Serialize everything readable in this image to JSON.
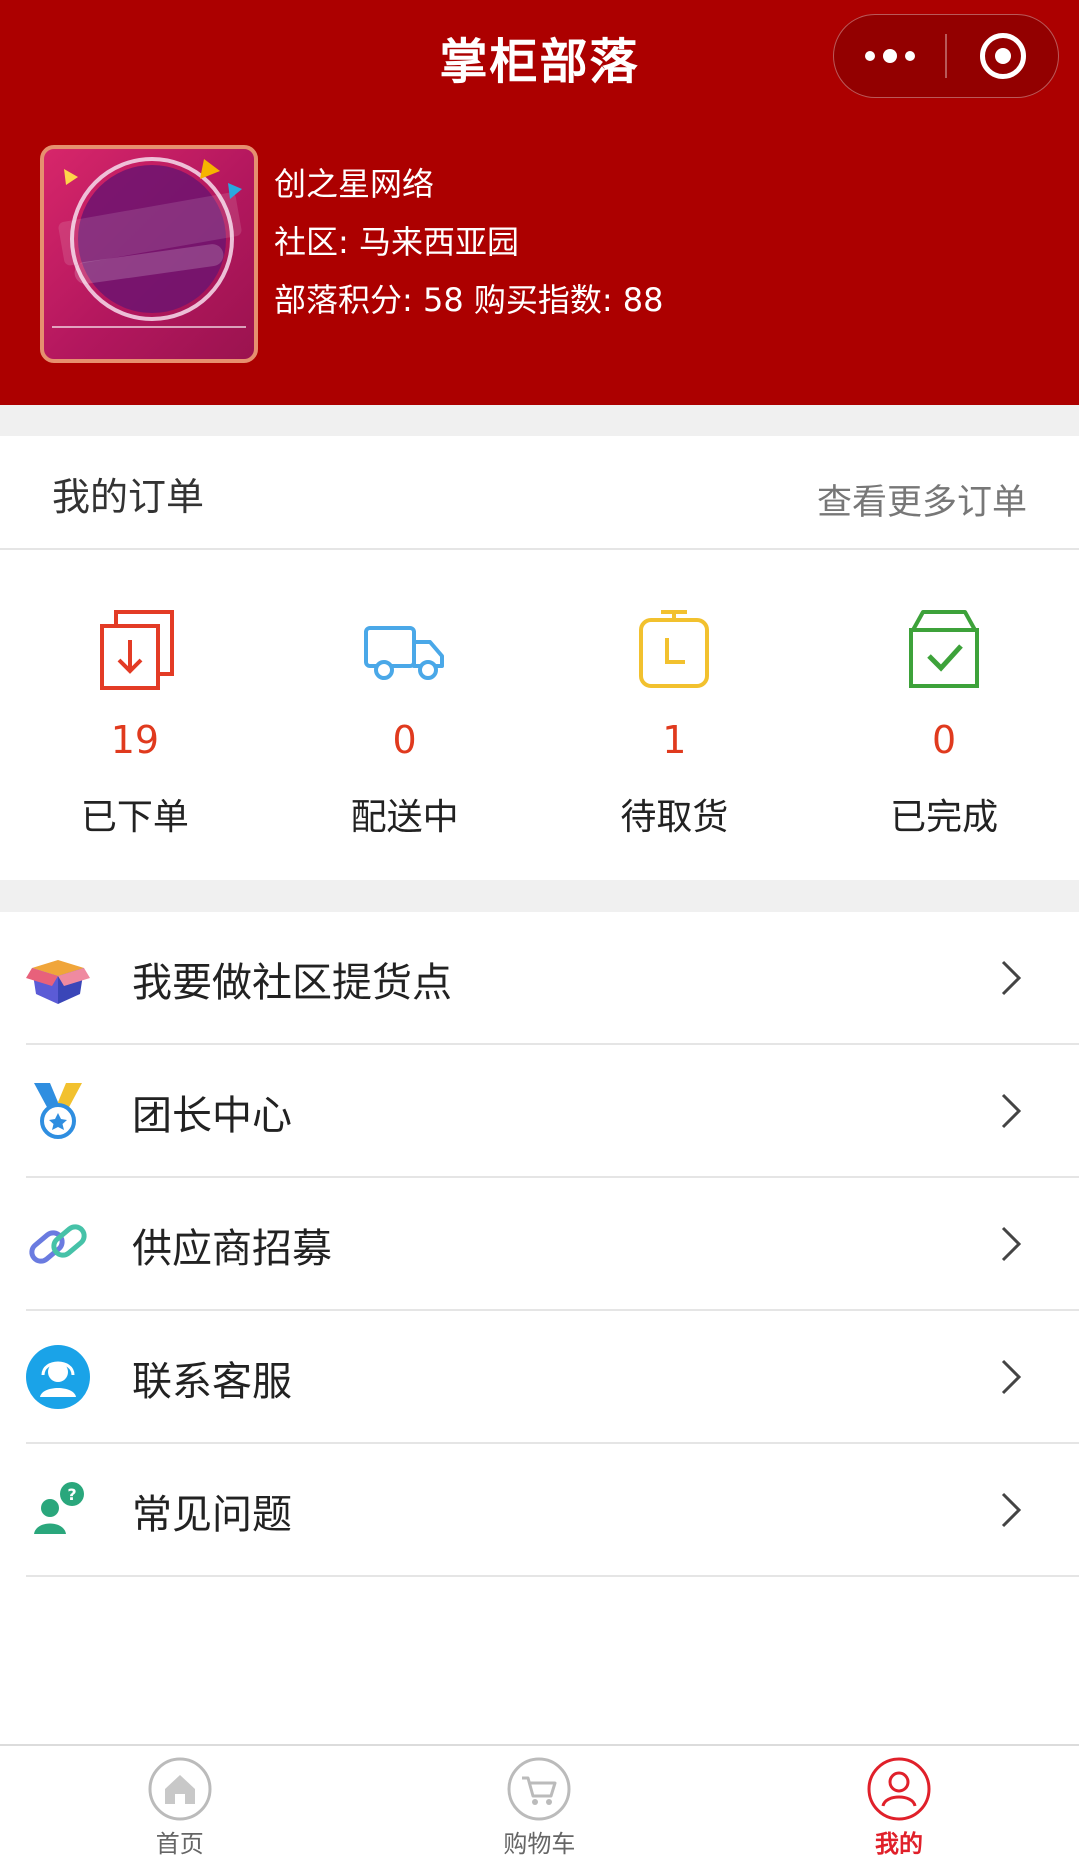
{
  "header": {
    "title": "掌柜部落",
    "menu_icon": "more-dots-icon",
    "close_icon": "target-circle-icon",
    "background": "#ac0000"
  },
  "profile": {
    "avatar_icon": "wechat-promo-avatar",
    "name": "创之星网络",
    "community": "社区: 马来西亚园",
    "stats": "部落积分: 58 购买指数: 88"
  },
  "orders": {
    "title": "我的订单",
    "more_link": "查看更多订单",
    "items": [
      {
        "icon": "order-placed-icon",
        "count": "19",
        "label": "已下单",
        "color": "#e33b25"
      },
      {
        "icon": "delivery-truck-icon",
        "count": "0",
        "label": "配送中",
        "color": "#4aa8e8"
      },
      {
        "icon": "pickup-clock-icon",
        "count": "1",
        "label": "待取货",
        "color": "#f2c12e"
      },
      {
        "icon": "completed-box-icon",
        "count": "0",
        "label": "已完成",
        "color": "#3da23a"
      }
    ]
  },
  "menu": {
    "items": [
      {
        "icon": "package-box-icon",
        "label": "我要做社区提货点"
      },
      {
        "icon": "medal-icon",
        "label": "团长中心"
      },
      {
        "icon": "link-icon",
        "label": "供应商招募"
      },
      {
        "icon": "customer-service-icon",
        "label": "联系客服"
      },
      {
        "icon": "faq-icon",
        "label": "常见问题"
      }
    ]
  },
  "tabbar": {
    "items": [
      {
        "icon": "home-icon",
        "label": "首页",
        "active": false
      },
      {
        "icon": "cart-icon",
        "label": "购物车",
        "active": false
      },
      {
        "icon": "user-icon",
        "label": "我的",
        "active": true
      }
    ],
    "active_color": "#e0202a"
  }
}
